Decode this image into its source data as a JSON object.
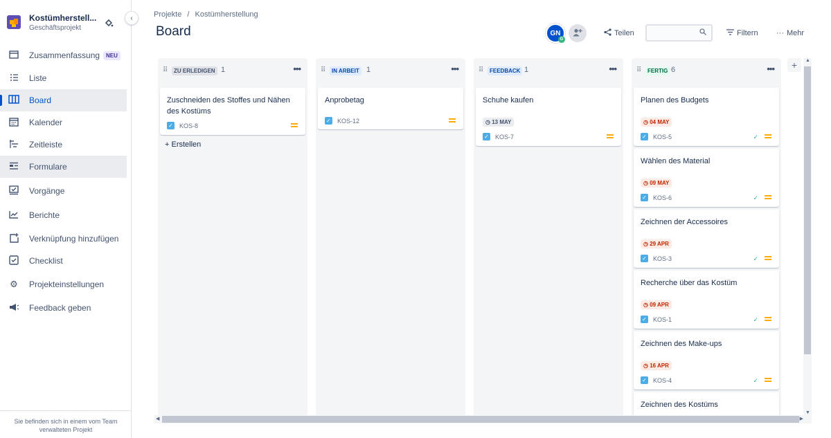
{
  "project": {
    "name": "Kostümherstell...",
    "type": "Geschäftsprojekt"
  },
  "sidebar": {
    "items": [
      {
        "label": "Zusammenfassung",
        "badge": "NEU",
        "icon": "summary-icon"
      },
      {
        "label": "Liste",
        "icon": "list-icon"
      },
      {
        "label": "Board",
        "icon": "board-icon"
      },
      {
        "label": "Kalender",
        "icon": "calendar-icon"
      },
      {
        "label": "Zeitleiste",
        "icon": "timeline-icon"
      },
      {
        "label": "Formulare",
        "icon": "forms-icon"
      },
      {
        "label": "Vorgänge",
        "icon": "issues-icon"
      },
      {
        "label": "Berichte",
        "icon": "reports-icon"
      },
      {
        "label": "Verknüpfung hinzufügen",
        "icon": "add-shortcut-icon"
      },
      {
        "label": "Checklist",
        "icon": "checklist-icon"
      },
      {
        "label": "Projekteinstellungen",
        "icon": "settings-icon"
      },
      {
        "label": "Feedback geben",
        "icon": "megaphone-icon"
      }
    ],
    "footer": "Sie befinden sich in einem vom Team verwalteten Projekt"
  },
  "header": {
    "breadcrumb": [
      "Projekte",
      "Kostümherstellung"
    ],
    "breadcrumb_sep": "/",
    "title": "Board",
    "avatar_initials": "GN",
    "avatar_badge": "G",
    "share_label": "Teilen",
    "search_value": "",
    "filter_label": "Filtern",
    "more_label": "Mehr"
  },
  "columns": [
    {
      "name": "ZU ERLEDIGEN",
      "count": "1",
      "color": "#dfe1e6",
      "text_color": "#42526e",
      "cards": [
        {
          "title": "Zuschneiden des Stoffes und Nähen des Kostüms",
          "key": "KOS-8"
        }
      ],
      "create_label": "+ Erstellen"
    },
    {
      "name": "IN ARBEIT",
      "count": "1",
      "color": "#deebff",
      "text_color": "#0747a6",
      "cards": [
        {
          "title": "Anprobetag",
          "key": "KOS-12"
        }
      ]
    },
    {
      "name": "FEEDBACK",
      "count": "1",
      "color": "#deebff",
      "text_color": "#0747a6",
      "cards": [
        {
          "title": "Schuhe kaufen",
          "key": "KOS-7",
          "date": "13 MAY"
        }
      ]
    },
    {
      "name": "FERTIG",
      "count": "6",
      "color": "#e3fcef",
      "text_color": "#006644",
      "cards": [
        {
          "title": "Planen des Budgets",
          "key": "KOS-5",
          "date": "04 MAY"
        },
        {
          "title": "Wählen des Material",
          "key": "KOS-6",
          "date": "09 MAY"
        },
        {
          "title": "Zeichnen der Accessoires",
          "key": "KOS-3",
          "date": "29 APR"
        },
        {
          "title": "Recherche über das Kostüm",
          "key": "KOS-1",
          "date": "09 APR"
        },
        {
          "title": "Zeichnen des Make-ups",
          "key": "KOS-4",
          "date": "16 APR"
        },
        {
          "title": "Zeichnen des Kostüms"
        }
      ]
    }
  ]
}
